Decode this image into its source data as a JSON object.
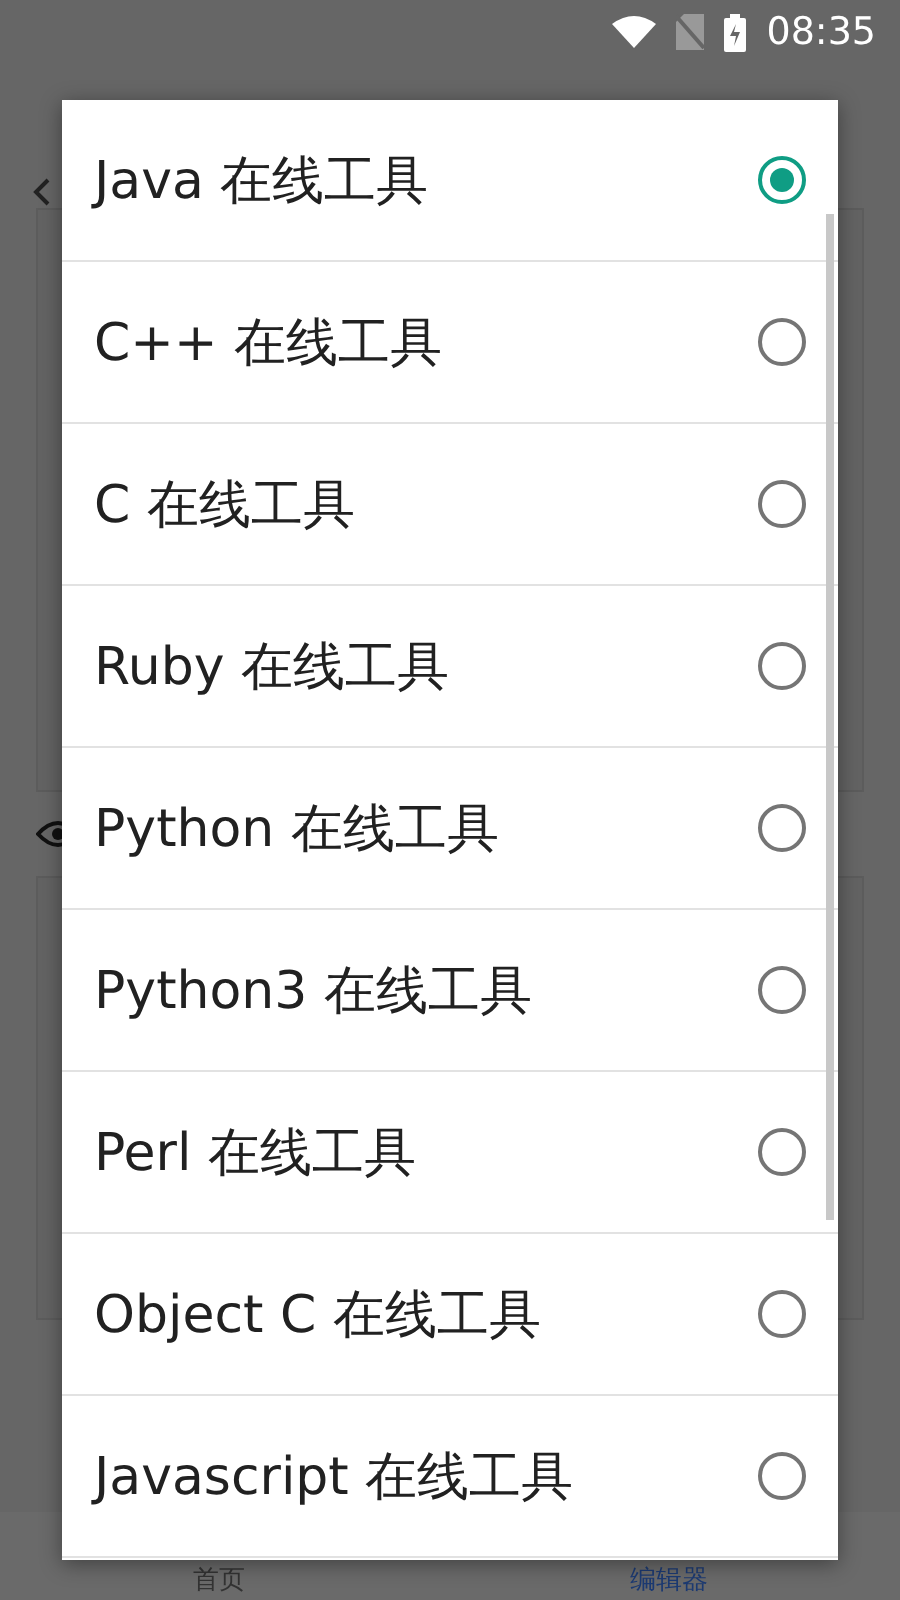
{
  "status_bar": {
    "time": "08:35"
  },
  "bottom_nav": [
    {
      "label": "首页",
      "selected": false
    },
    {
      "label": "编辑器",
      "selected": true
    }
  ],
  "dialog": {
    "options": [
      {
        "label": "Java 在线工具",
        "selected": true
      },
      {
        "label": "C++ 在线工具",
        "selected": false
      },
      {
        "label": "C 在线工具",
        "selected": false
      },
      {
        "label": "Ruby 在线工具",
        "selected": false
      },
      {
        "label": "Python 在线工具",
        "selected": false
      },
      {
        "label": "Python3 在线工具",
        "selected": false
      },
      {
        "label": "Perl 在线工具",
        "selected": false
      },
      {
        "label": "Object C 在线工具",
        "selected": false
      },
      {
        "label": "Javascript 在线工具",
        "selected": false
      }
    ]
  }
}
